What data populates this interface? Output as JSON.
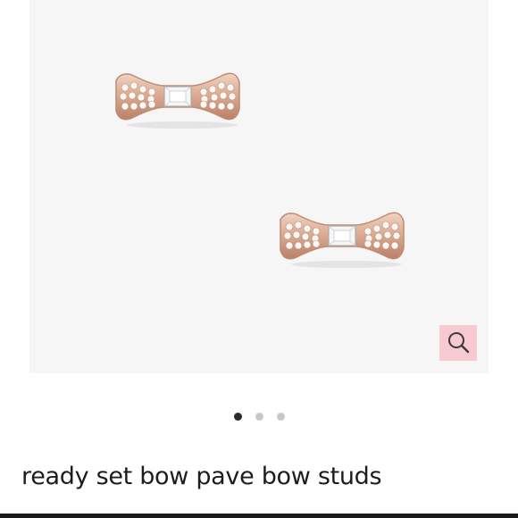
{
  "product": {
    "title": "ready set bow pave bow studs"
  },
  "gallery": {
    "image_count": 3,
    "active_index": 0
  },
  "zoom": {
    "icon": "magnifier-icon"
  },
  "colors": {
    "image_background": "#f6f6f7",
    "zoom_button": "#f7c9d1",
    "rose_gold": "#d9a98f",
    "dot_active": "#2b2b2b",
    "dot_inactive": "#c8c8c8"
  }
}
